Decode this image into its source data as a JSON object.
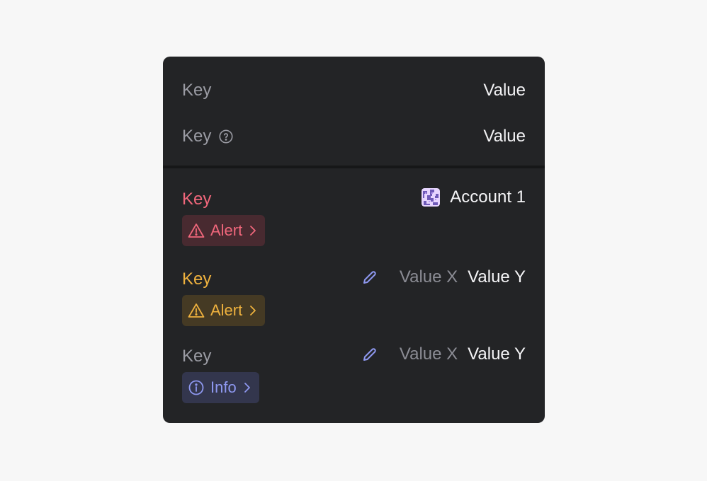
{
  "summary": {
    "rows": [
      {
        "key": "Key",
        "value": "Value"
      },
      {
        "key": "Key",
        "value": "Value",
        "icon": "help-circle-icon"
      }
    ]
  },
  "details": {
    "account_row": {
      "key": "Key",
      "key_color": "#f0677b",
      "badge": {
        "label": "Alert",
        "icon": "warning-triangle-icon",
        "kind": "alert-red"
      },
      "value": "Account 1",
      "avatar": "account-avatar-icon"
    },
    "change_row_1": {
      "key": "Key",
      "key_color": "#eeb13e",
      "badge": {
        "label": "Alert",
        "icon": "warning-triangle-icon",
        "kind": "alert-yellow"
      },
      "value_old": "Value X",
      "value_new": "Value Y",
      "edit_icon": "pencil-icon"
    },
    "change_row_2": {
      "key": "Key",
      "badge": {
        "label": "Info",
        "icon": "info-circle-icon",
        "kind": "info-blue"
      },
      "value_old": "Value X",
      "value_new": "Value Y",
      "edit_icon": "pencil-icon"
    }
  }
}
